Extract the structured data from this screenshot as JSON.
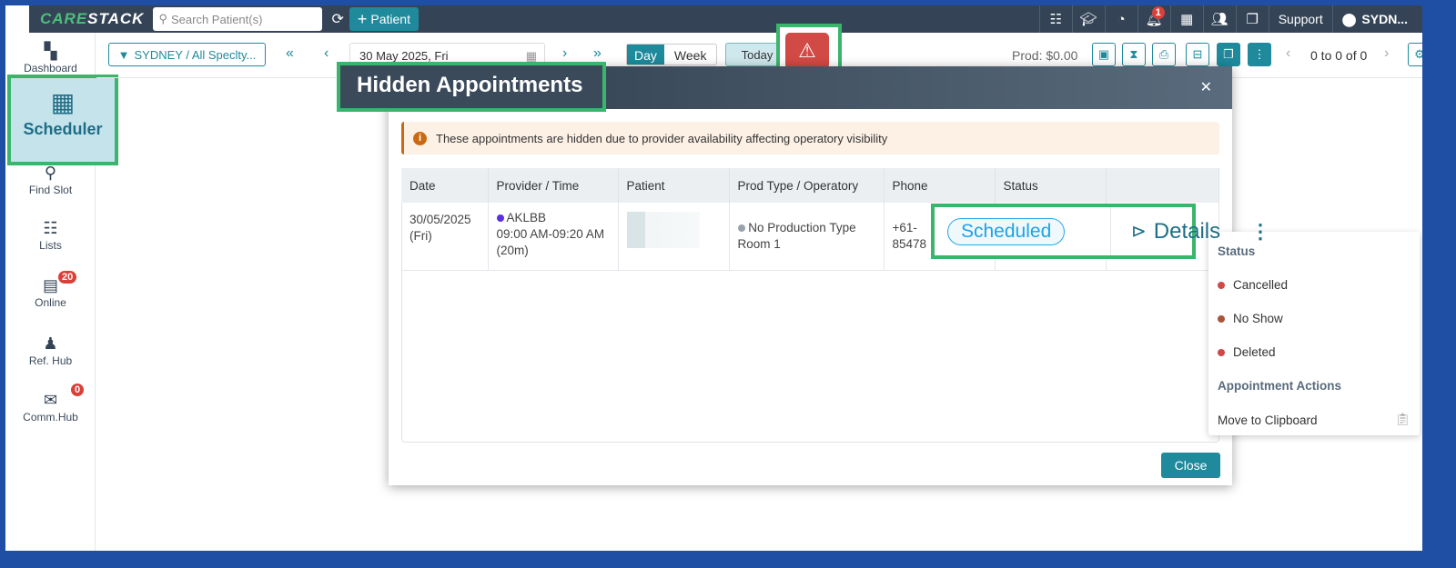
{
  "topbar": {
    "logo": "CARESTACK",
    "search_placeholder": "Search Patient(s)",
    "add_patient": "Patient",
    "notifications_count": "1",
    "support": "Support",
    "location": "SYDN..."
  },
  "sidebar": {
    "items": [
      {
        "label": "Dashboard"
      },
      {
        "label": "Scheduler"
      },
      {
        "label": "Find Slot"
      },
      {
        "label": "Lists"
      },
      {
        "label": "Online",
        "badge": "20"
      },
      {
        "label": "Ref. Hub"
      },
      {
        "label": "Comm.Hub",
        "badge": "0"
      }
    ]
  },
  "toolbar": {
    "filter": "SYDNEY / All Speclty...",
    "date": "30 May 2025, Fri",
    "day": "Day",
    "week": "Week",
    "today": "Today",
    "prod": "Prod: $0.00",
    "pager": "0 to 0 of 0"
  },
  "modal": {
    "title": "Hidden Appointments",
    "alert": "These appointments are hidden due to provider availability affecting operatory visibility",
    "close": "Close",
    "columns": [
      "Date",
      "Provider / Time",
      "Patient",
      "Prod Type / Operatory",
      "Phone",
      "Status",
      ""
    ],
    "row": {
      "date": "30/05/2025",
      "day": "(Fri)",
      "provider": "AKLBB",
      "time": "09:00 AM-09:20 AM",
      "duration": "(20m)",
      "prod_type": "No Production Type",
      "operatory": "Room 1",
      "phone1": "+61-",
      "phone2": "85478",
      "status": "Scheduled",
      "details": "Details"
    }
  },
  "menu": {
    "section1": "Status",
    "items": [
      {
        "label": "Cancelled",
        "color": "#d04848"
      },
      {
        "label": "No Show",
        "color": "#a8553b"
      },
      {
        "label": "Deleted",
        "color": "#d04848"
      }
    ],
    "section2": "Appointment Actions",
    "action": "Move to Clipboard"
  },
  "colors": {
    "accent": "#1e8a9c",
    "header": "#344456",
    "alert_red": "#d9403a",
    "highlight": "#3bb56c"
  }
}
